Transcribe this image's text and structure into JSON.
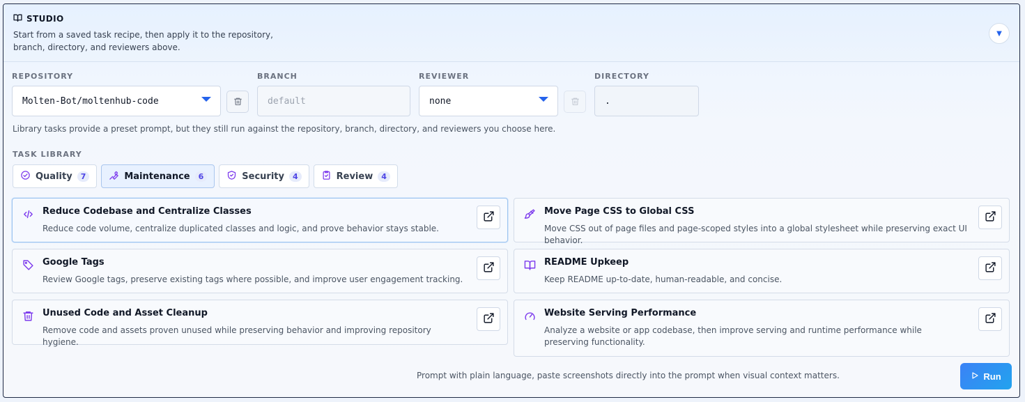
{
  "header": {
    "title": "STUDIO",
    "description": "Start from a saved task recipe, then apply it to the repository, branch, directory, and reviewers above.",
    "collapse_glyph": "▼"
  },
  "fields": {
    "repository": {
      "label": "REPOSITORY",
      "value": "Molten-Bot/moltenhub-code"
    },
    "branch": {
      "label": "BRANCH",
      "placeholder": "default",
      "value": ""
    },
    "reviewer": {
      "label": "REVIEWER",
      "value": "none"
    },
    "directory": {
      "label": "DIRECTORY",
      "value": "."
    }
  },
  "note": "Library tasks provide a preset prompt, but they still run against the repository, branch, directory, and reviewers you choose here.",
  "library": {
    "label": "TASK LIBRARY",
    "tabs": [
      {
        "label": "Quality",
        "count": "7",
        "icon": "check-circle-icon",
        "active": false
      },
      {
        "label": "Maintenance",
        "count": "6",
        "icon": "wrench-icon",
        "active": true
      },
      {
        "label": "Security",
        "count": "4",
        "icon": "shield-check-icon",
        "active": false
      },
      {
        "label": "Review",
        "count": "4",
        "icon": "clipboard-check-icon",
        "active": false
      }
    ],
    "cards": [
      {
        "title": "Reduce Codebase and Centralize Classes",
        "description": "Reduce code volume, centralize duplicated classes and logic, and prove behavior stays stable.",
        "icon": "code-icon",
        "selected": true
      },
      {
        "title": "Move Page CSS to Global CSS",
        "description": "Move CSS out of page files and page-scoped styles into a global stylesheet while preserving exact UI behavior.",
        "icon": "paintbrush-icon",
        "selected": false
      },
      {
        "title": "Google Tags",
        "description": "Review Google tags, preserve existing tags where possible, and improve user engagement tracking.",
        "icon": "tag-icon",
        "selected": false
      },
      {
        "title": "README Upkeep",
        "description": "Keep README up-to-date, human-readable, and concise.",
        "icon": "book-icon",
        "selected": false
      },
      {
        "title": "Unused Code and Asset Cleanup",
        "description": "Remove code and assets proven unused while preserving behavior and improving repository hygiene.",
        "icon": "trash-icon",
        "selected": false
      },
      {
        "title": "Website Serving Performance",
        "description": "Analyze a website or app codebase, then improve serving and runtime performance while preserving functionality.",
        "icon": "gauge-icon",
        "selected": false
      }
    ]
  },
  "footer": {
    "hint": "Prompt with plain language, paste screenshots directly into the prompt when visual context matters.",
    "run_label": "Run"
  },
  "colors": {
    "accent": "#2563eb",
    "icon": "#7c3aed",
    "run_button": "#3b82f6"
  }
}
